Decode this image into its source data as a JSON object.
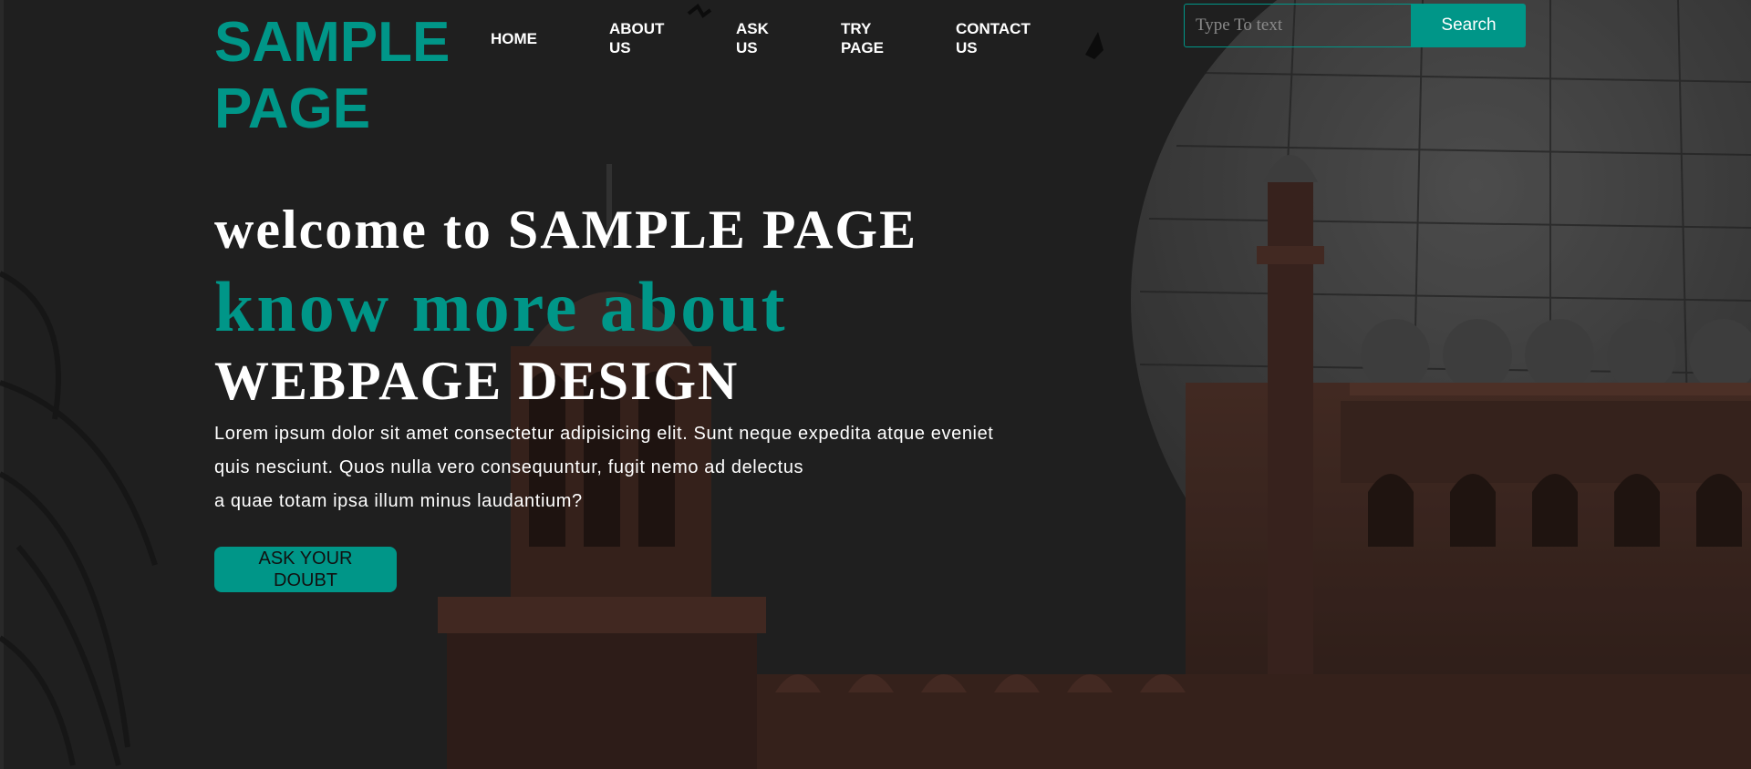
{
  "brand": {
    "line1": "SAMPLE",
    "line2": "PAGE",
    "color": "#009688"
  },
  "nav": [
    {
      "line1": "HOME",
      "line2": ""
    },
    {
      "line1": "ABOUT",
      "line2": "US"
    },
    {
      "line1": "ASK",
      "line2": "US"
    },
    {
      "line1": "TRY",
      "line2": "PAGE"
    },
    {
      "line1": "CONTACT",
      "line2": "US"
    }
  ],
  "search": {
    "placeholder": "Type To text",
    "button_label": "Search"
  },
  "hero": {
    "welcome": "welcome to SAMPLE PAGE",
    "know_more": "know more about",
    "design": "WEBPAGE DESIGN",
    "paragraph": [
      "Lorem ipsum dolor sit amet consectetur adipisicing elit. Sunt neque expedita atque eveniet",
      "quis nesciunt. Quos nulla vero consequuntur, fugit nemo ad delectus",
      "a quae totam ipsa illum minus laudantium?"
    ],
    "cta": {
      "line1": "ASK YOUR",
      "line2": "DOUBT"
    }
  },
  "colors": {
    "accent": "#009688",
    "background": "#2b2b2b",
    "text": "#ffffff"
  },
  "background_image": "dimmed photo of a domed mosque with red sandstone minarets and palm fronds"
}
